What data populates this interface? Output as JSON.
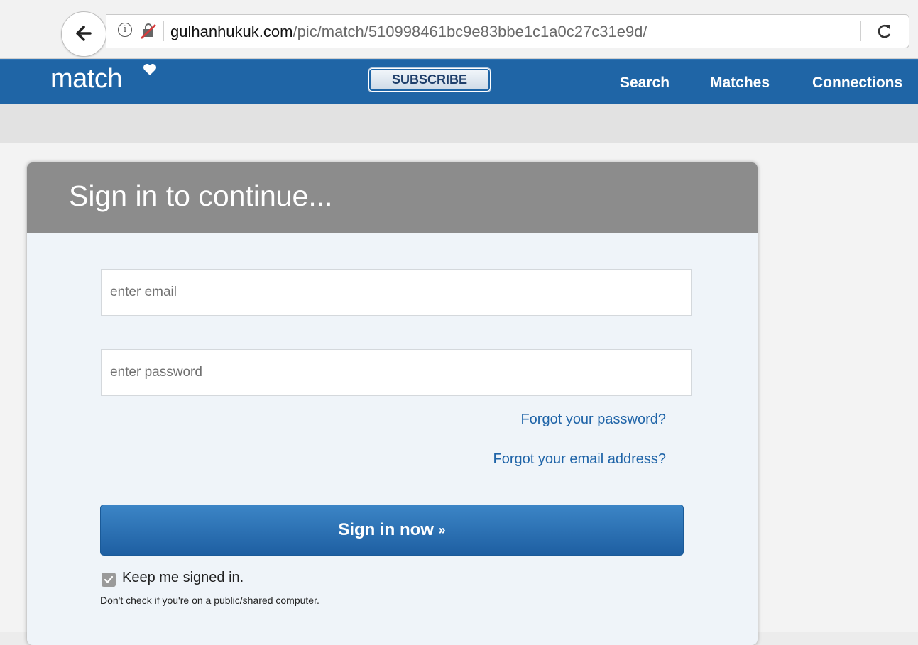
{
  "browser": {
    "url_domain": "gulhanhukuk.com",
    "url_path": "/pic/match/510998461bc9e83bbe1c1a0c27c31e9d/",
    "icons": [
      "back-arrow-icon",
      "info-icon",
      "insecure-lock-icon",
      "reload-icon"
    ]
  },
  "nav": {
    "logo": "match",
    "subscribe": "SUBSCRIBE",
    "links": [
      "Search",
      "Matches",
      "Connections"
    ]
  },
  "signin": {
    "title": "Sign in to continue...",
    "email_placeholder": "enter email",
    "password_placeholder": "enter password",
    "forgot_password": "Forgot your password?",
    "forgot_email": "Forgot your email address?",
    "button": "Sign in now",
    "button_arrow": "»",
    "keep_signed_in": "Keep me signed in.",
    "keep_note": "Don't check if you're on a public/shared computer.",
    "keep_checked": true
  },
  "colors": {
    "nav_blue": "#1f65a6",
    "header_grey": "#8c8c8c",
    "link_blue": "#1f64a8"
  }
}
